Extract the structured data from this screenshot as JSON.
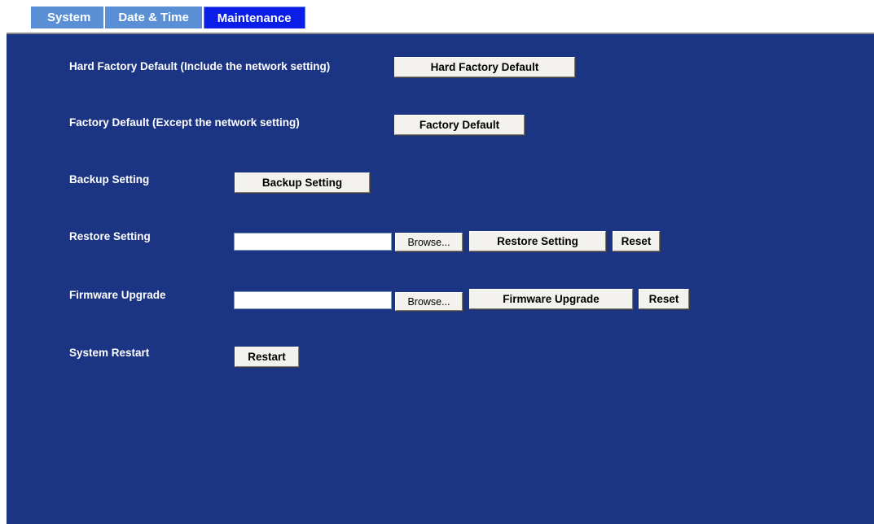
{
  "tabs": [
    {
      "label": "System",
      "active": false
    },
    {
      "label": "Date & Time",
      "active": false
    },
    {
      "label": "Maintenance",
      "active": true
    }
  ],
  "hard_factory": {
    "label": "Hard Factory Default (Include the network setting)",
    "button": "Hard Factory Default"
  },
  "factory": {
    "label": "Factory Default (Except the network setting)",
    "button": "Factory Default"
  },
  "backup": {
    "label": "Backup Setting",
    "button": "Backup Setting"
  },
  "restore": {
    "label": "Restore Setting",
    "file_value": "",
    "browse": "Browse...",
    "button": "Restore Setting",
    "reset": "Reset"
  },
  "firmware": {
    "label": "Firmware Upgrade",
    "file_value": "",
    "browse": "Browse...",
    "button": "Firmware Upgrade",
    "reset": "Reset"
  },
  "restart": {
    "label": "System Restart",
    "button": "Restart"
  },
  "colors": {
    "panel_bg": "#1c3484",
    "tab_bg": "#5a8fd6",
    "tab_active_bg": "#0a1ee8"
  }
}
